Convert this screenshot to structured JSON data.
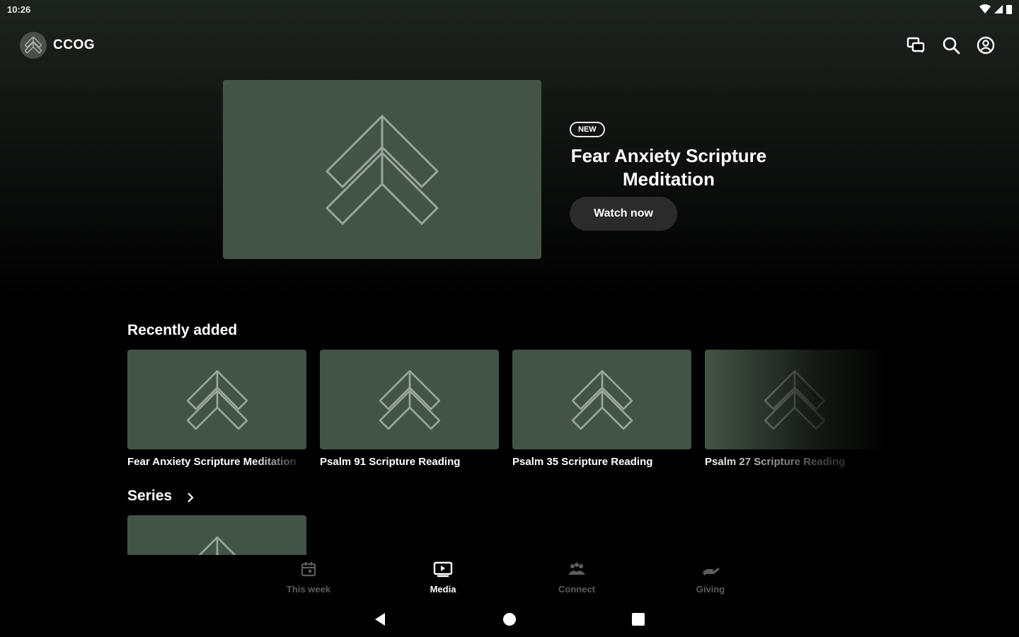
{
  "status_bar": {
    "time": "10:26"
  },
  "app": {
    "name": "CCOG"
  },
  "colors": {
    "accent": "#435446",
    "background": "#000000",
    "button": "#2b2b2b",
    "inactive_nav": "#5d5d5d"
  },
  "hero": {
    "badge": "NEW",
    "title": "Fear Anxiety Scripture Meditation",
    "button_label": "Watch now"
  },
  "recently_added": {
    "title": "Recently added",
    "items": [
      {
        "title": "Fear Anxiety Scripture Meditation"
      },
      {
        "title": "Psalm 91 Scripture Reading"
      },
      {
        "title": "Psalm 35 Scripture Reading"
      },
      {
        "title": "Psalm 27 Scripture Reading"
      }
    ]
  },
  "series": {
    "title": "Series"
  },
  "bottom_nav": {
    "items": [
      {
        "label": "This week",
        "icon": "calendar-icon"
      },
      {
        "label": "Media",
        "icon": "play-screen-icon",
        "active": true
      },
      {
        "label": "Connect",
        "icon": "people-icon"
      },
      {
        "label": "Giving",
        "icon": "giving-hand-icon"
      }
    ]
  }
}
